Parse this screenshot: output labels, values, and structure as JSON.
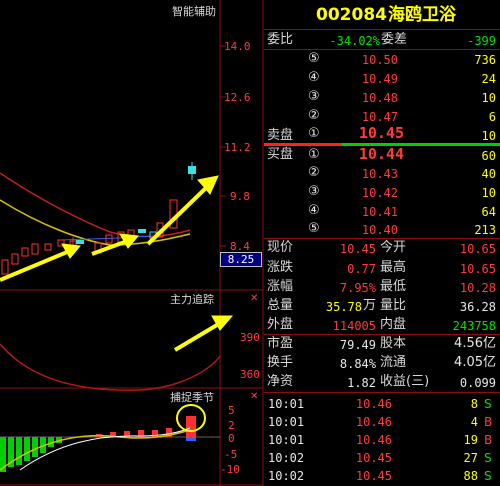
{
  "stock": {
    "code": "002084",
    "name": "海鸥卫浴"
  },
  "weibi": {
    "label": "委比",
    "value": "-34.02%",
    "diff_label": "委差",
    "diff_value": "-399"
  },
  "sell_label": "卖盘",
  "buy_label": "买盘",
  "asks": [
    {
      "level": "⑤",
      "price": "10.50",
      "volume": "736"
    },
    {
      "level": "④",
      "price": "10.49",
      "volume": "24"
    },
    {
      "level": "③",
      "price": "10.48",
      "volume": "10"
    },
    {
      "level": "②",
      "price": "10.47",
      "volume": "6"
    },
    {
      "level": "①",
      "price": "10.45",
      "volume": "10"
    }
  ],
  "bids": [
    {
      "level": "①",
      "price": "10.44",
      "volume": "60"
    },
    {
      "level": "②",
      "price": "10.43",
      "volume": "40"
    },
    {
      "level": "③",
      "price": "10.42",
      "volume": "10"
    },
    {
      "level": "④",
      "price": "10.41",
      "volume": "64"
    },
    {
      "level": "⑤",
      "price": "10.40",
      "volume": "213"
    }
  ],
  "quote": {
    "xianjia_label": "现价",
    "xianjia": "10.45",
    "jinkai_label": "今开",
    "jinkai": "10.65",
    "zhangdie_label": "涨跌",
    "zhangdie": "0.77",
    "zuigao_label": "最高",
    "zuigao": "10.65",
    "zhangfu_label": "涨幅",
    "zhangfu": "7.95%",
    "zuidi_label": "最低",
    "zuidi": "10.28",
    "zongliang_label": "总量",
    "zongliang": "35.78",
    "zongliang_unit": "万",
    "liangbi_label": "量比",
    "liangbi": "36.28",
    "waipan_label": "外盘",
    "waipan": "114005",
    "neipan_label": "内盘",
    "neipan": "243758",
    "shiying_label": "市盈",
    "shiying": "79.49",
    "guben_label": "股本",
    "guben": "4.56亿",
    "huanshou_label": "换手",
    "huanshou": "8.84%",
    "liutong_label": "流通",
    "liutong": "4.05亿",
    "jingzi_label": "净资",
    "jingzi": "1.82",
    "shouyi_label": "收益(三)",
    "shouyi": "0.099"
  },
  "ticks": [
    {
      "time": "10:01",
      "price": "10.46",
      "vol": "8",
      "dir": "S"
    },
    {
      "time": "10:01",
      "price": "10.46",
      "vol": "4",
      "dir": "B"
    },
    {
      "time": "10:01",
      "price": "10.46",
      "vol": "19",
      "dir": "B"
    },
    {
      "time": "10:02",
      "price": "10.45",
      "vol": "27",
      "dir": "S"
    },
    {
      "time": "10:02",
      "price": "10.45",
      "vol": "88",
      "dir": "S"
    }
  ],
  "panels": {
    "main_title": "智能辅助",
    "main_axis": [
      "14.0",
      "12.6",
      "11.2",
      "9.8",
      "8.4"
    ],
    "price_tag": "8.25",
    "mid_title": "主力追踪",
    "mid_axis": [
      "390",
      "360"
    ],
    "low_title": "捕捉季节",
    "low_axis": [
      "5",
      "2",
      "0",
      "-5",
      "-10"
    ]
  }
}
